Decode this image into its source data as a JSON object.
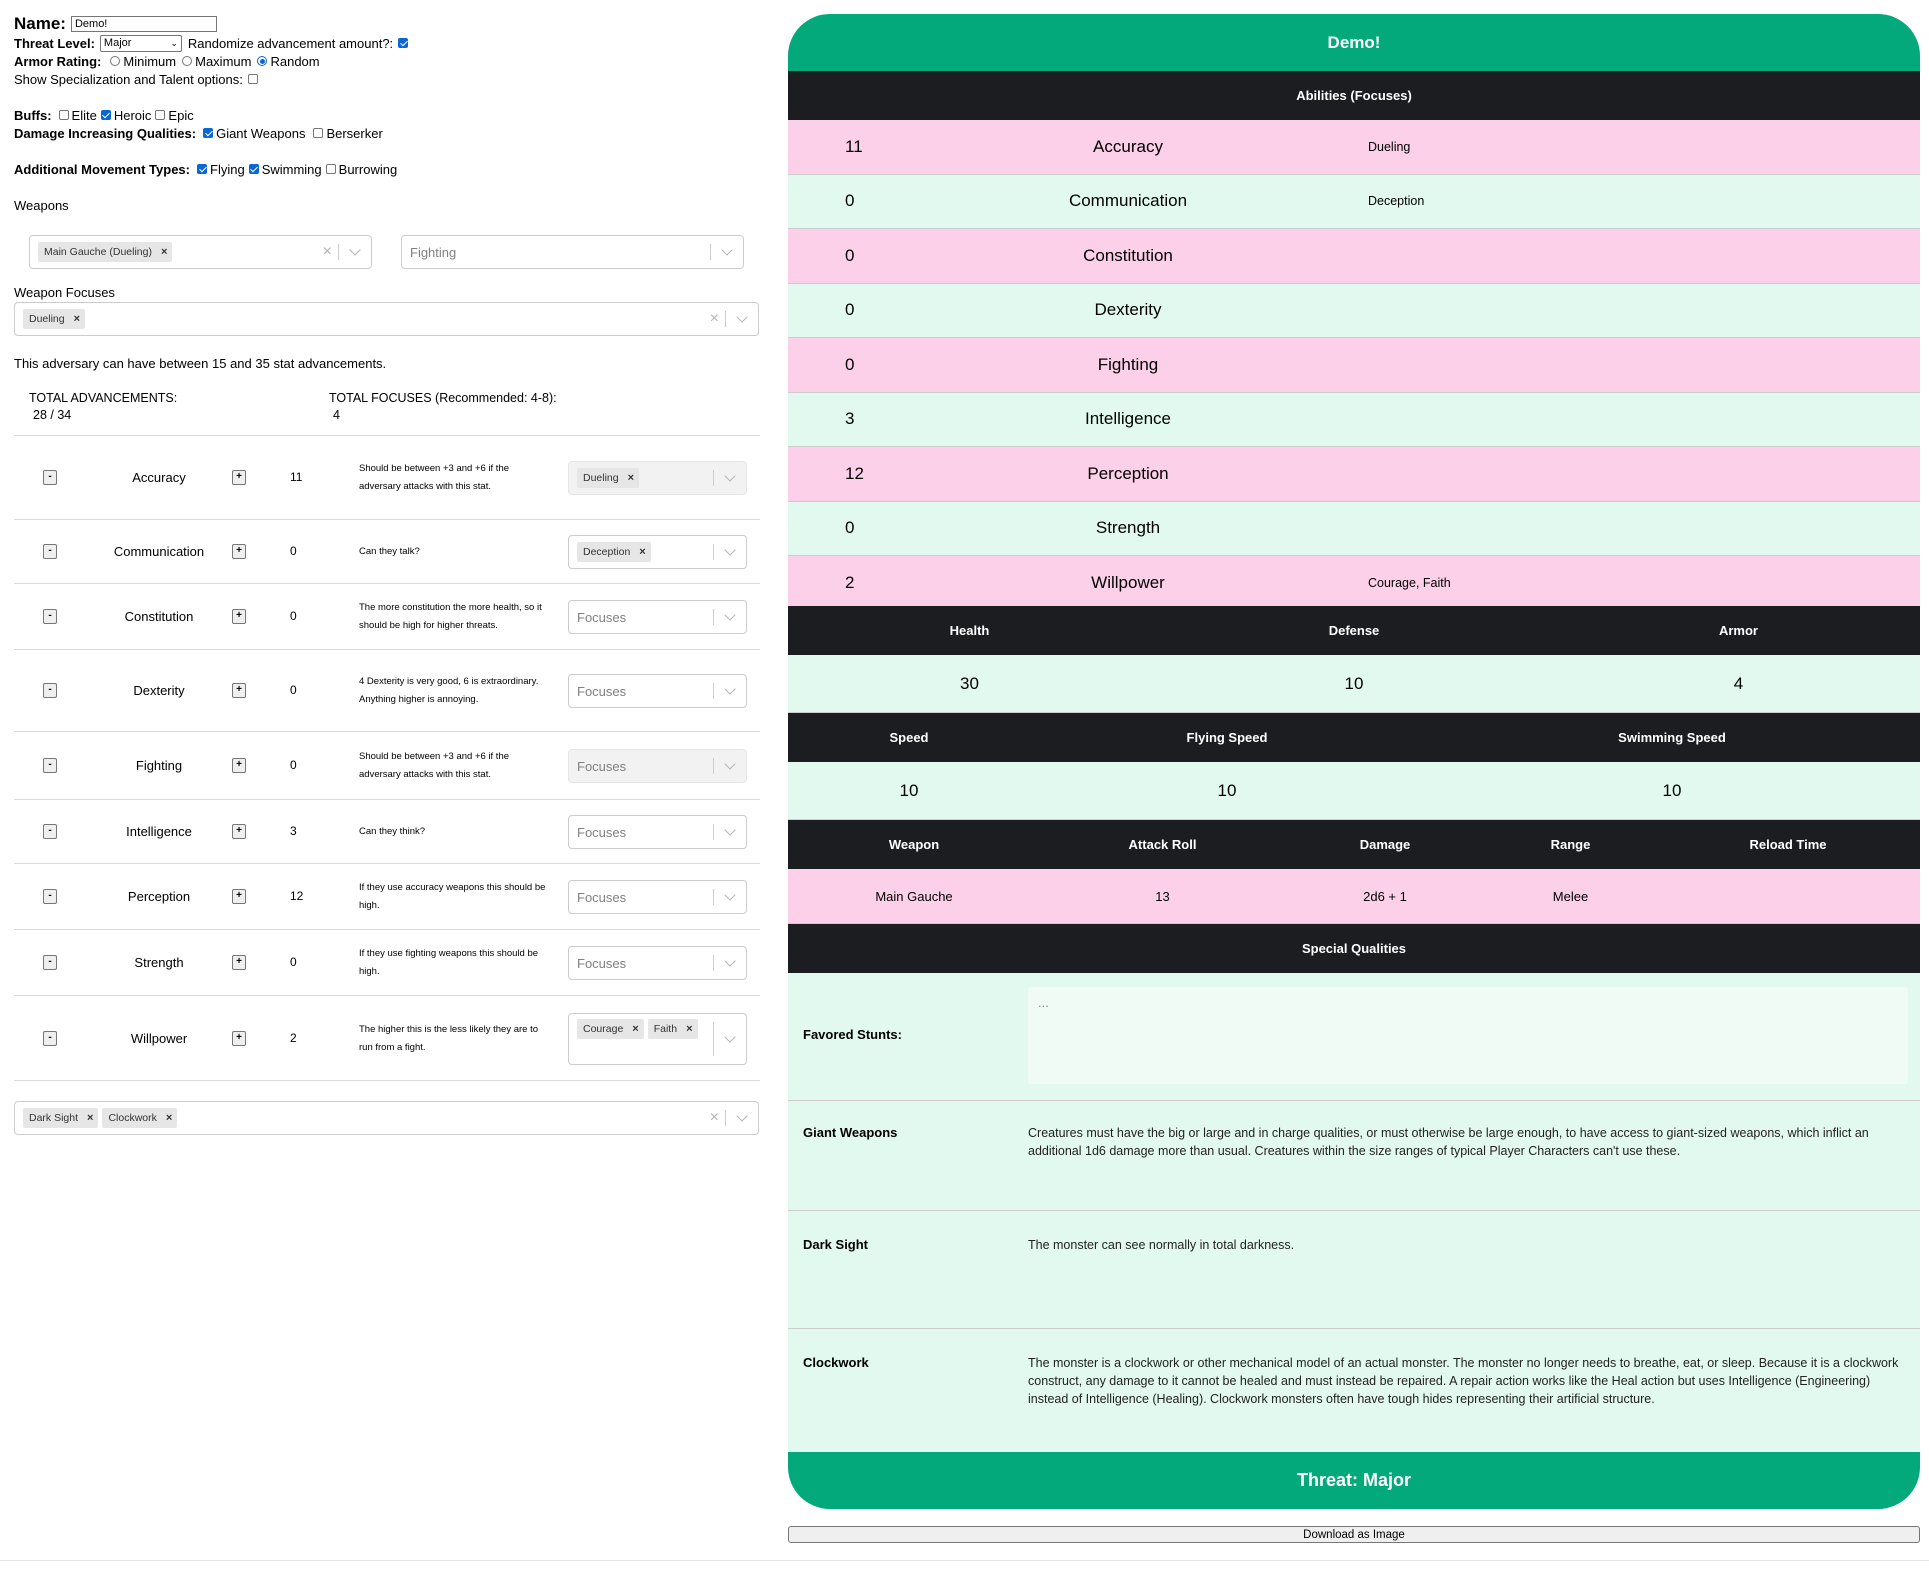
{
  "form": {
    "name_label": "Name:",
    "name_value": "Demo!",
    "threat_label": "Threat Level:",
    "threat_value": "Major",
    "randomize_label": "Randomize advancement amount?:",
    "armor_label": "Armor Rating:",
    "armor_options": [
      "Minimum",
      "Maximum",
      "Random"
    ],
    "armor_selected": "Random",
    "spec_label": "Show Specialization and Talent options:",
    "buffs_label": "Buffs:",
    "buffs": [
      {
        "label": "Elite",
        "checked": false
      },
      {
        "label": "Heroic",
        "checked": true
      },
      {
        "label": "Epic",
        "checked": false
      }
    ],
    "dmg_label": "Damage Increasing Qualities:",
    "dmg_qualities": [
      {
        "label": "Giant Weapons",
        "checked": true
      },
      {
        "label": "Berserker",
        "checked": false
      }
    ],
    "move_label": "Additional Movement Types:",
    "move_types": [
      {
        "label": "Flying",
        "checked": true
      },
      {
        "label": "Swimming",
        "checked": true
      },
      {
        "label": "Burrowing",
        "checked": false
      }
    ],
    "weapons_label": "Weapons",
    "weapon_chip": "Main Gauche (Dueling)",
    "weapon_group_placeholder": "Fighting",
    "weapon_focuses_label": "Weapon Focuses",
    "weapon_focus_chip": "Dueling",
    "advancement_note": "This adversary can have between 15 and 35 stat advancements.",
    "total_adv_label": "TOTAL ADVANCEMENTS:",
    "total_adv_value": "28 / 34",
    "total_focus_label": "TOTAL FOCUSES (Recommended: 4-8):",
    "total_focus_value": "4",
    "focus_placeholder": "Focuses",
    "minus": "-",
    "plus": "+",
    "qualities_chips": [
      "Dark Sight",
      "Clockwork"
    ]
  },
  "stats": [
    {
      "name": "Accuracy",
      "value": "11",
      "desc": "Should be between +3 and +6 if the adversary attacks with this stat.",
      "focuses": [
        "Dueling"
      ],
      "disabled": true
    },
    {
      "name": "Communication",
      "value": "0",
      "desc": "Can they talk?",
      "focuses": [
        "Deception"
      ]
    },
    {
      "name": "Constitution",
      "value": "0",
      "desc": "The more constitution the more health, so it should be high for higher threats.",
      "focuses": []
    },
    {
      "name": "Dexterity",
      "value": "0",
      "desc": "4 Dexterity is very good, 6 is extraordinary. Anything higher is annoying.",
      "focuses": []
    },
    {
      "name": "Fighting",
      "value": "0",
      "desc": "Should be between +3 and +6 if the adversary attacks with this stat.",
      "focuses": [],
      "disabled": true
    },
    {
      "name": "Intelligence",
      "value": "3",
      "desc": "Can they think?",
      "focuses": []
    },
    {
      "name": "Perception",
      "value": "12",
      "desc": "If they use accuracy weapons this should be high.",
      "focuses": []
    },
    {
      "name": "Strength",
      "value": "0",
      "desc": "If they use fighting weapons this should be high.",
      "focuses": []
    },
    {
      "name": "Willpower",
      "value": "2",
      "desc": "The higher this is the less likely they are to run from a fight.",
      "focuses": [
        "Courage",
        "Faith"
      ]
    }
  ],
  "card": {
    "title": "Demo!",
    "abilities_header": "Abilities (Focuses)",
    "abilities": [
      {
        "value": "11",
        "name": "Accuracy",
        "focuses": "Dueling"
      },
      {
        "value": "0",
        "name": "Communication",
        "focuses": "Deception"
      },
      {
        "value": "0",
        "name": "Constitution",
        "focuses": ""
      },
      {
        "value": "0",
        "name": "Dexterity",
        "focuses": ""
      },
      {
        "value": "0",
        "name": "Fighting",
        "focuses": ""
      },
      {
        "value": "3",
        "name": "Intelligence",
        "focuses": ""
      },
      {
        "value": "12",
        "name": "Perception",
        "focuses": ""
      },
      {
        "value": "0",
        "name": "Strength",
        "focuses": ""
      },
      {
        "value": "2",
        "name": "Willpower",
        "focuses": "Courage, Faith"
      }
    ],
    "hda_headers": [
      "Health",
      "Defense",
      "Armor"
    ],
    "hda_values": [
      "30",
      "10",
      "4"
    ],
    "speed_headers": [
      "Speed",
      "Flying Speed",
      "Swimming Speed"
    ],
    "speed_values": [
      "10",
      "10",
      "10"
    ],
    "weapon_headers": [
      "Weapon",
      "Attack Roll",
      "Damage",
      "Range",
      "Reload Time"
    ],
    "weapon_rows": [
      [
        "Main Gauche",
        "13",
        "2d6 + 1",
        "Melee",
        ""
      ]
    ],
    "special_header": "Special Qualities",
    "favored_label": "Favored Stunts:",
    "favored_placeholder": "...",
    "qualities": [
      {
        "name": "Giant Weapons",
        "text": "Creatures must have the big or large and in charge qualities, or must otherwise be large enough, to have access to giant-sized weapons, which inflict an additional 1d6 damage more than usual. Creatures within the size ranges of typical Player Characters can't use these."
      },
      {
        "name": "Dark Sight",
        "text": "The monster can see normally in total darkness."
      },
      {
        "name": "Clockwork",
        "text": "The monster is a clockwork or other mechanical model of an actual monster. The monster no longer needs to breathe, eat, or sleep. Because it is a clockwork construct, any damage to it cannot be healed and must instead be repaired. A repair action works like the Heal action but uses Intelligence (Engineering) instead of Intelligence (Healing). Clockwork monsters often have tough hides representing their artificial structure."
      }
    ],
    "threat_footer": "Threat: Major"
  },
  "download_label": "Download as Image",
  "colors": {
    "accent_green": "#03a87b",
    "header_dark": "#1b1d21",
    "row_pink": "#fdd0e9",
    "row_mint": "#e2f9ef",
    "checkbox_blue": "#0b66d6"
  }
}
